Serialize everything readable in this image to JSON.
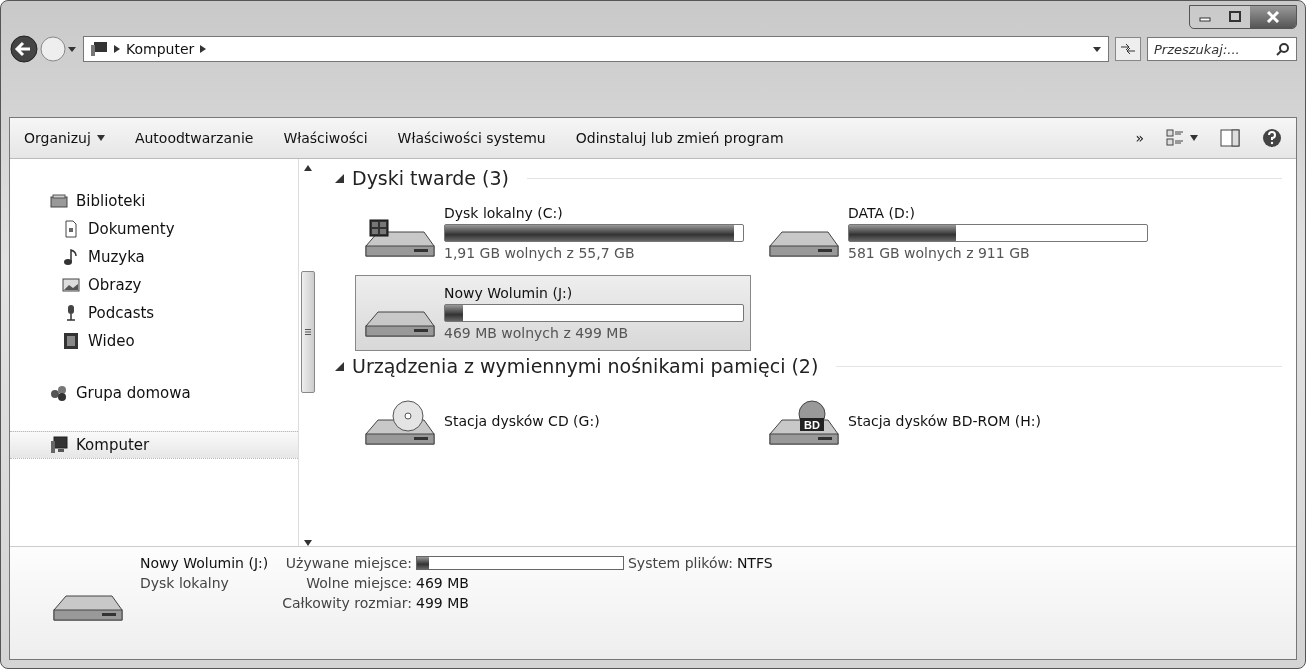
{
  "address_bar": {
    "crumbs": [
      "Komputer"
    ],
    "search": {
      "placeholder": "Przeszukaj:..."
    }
  },
  "toolbar": {
    "items": [
      {
        "label": "Organizuj",
        "dropdown": true
      },
      {
        "label": "Autoodtwarzanie",
        "dropdown": false
      },
      {
        "label": "Właściwości",
        "dropdown": false
      },
      {
        "label": "Właściwości systemu",
        "dropdown": false
      },
      {
        "label": "Odinstaluj lub zmień program",
        "dropdown": false
      }
    ],
    "overflow": "»"
  },
  "sidebar": {
    "groups": [
      {
        "label": "Biblioteki",
        "selected": false,
        "children": [
          {
            "label": "Dokumenty",
            "selected": false
          },
          {
            "label": "Muzyka",
            "selected": false
          },
          {
            "label": "Obrazy",
            "selected": false
          },
          {
            "label": "Podcasts",
            "selected": false
          },
          {
            "label": "Wideo",
            "selected": false
          }
        ]
      },
      {
        "label": "Grupa domowa",
        "selected": false
      },
      {
        "label": "Komputer",
        "selected": true
      }
    ]
  },
  "sections": [
    {
      "title": "Dyski twarde (3)",
      "expanded": true,
      "items": [
        {
          "name": "Dysk lokalny (C:)",
          "kind": "disk",
          "level": 0.97,
          "free": "1,91 GB wolnych z 55,7 GB",
          "selected": false
        },
        {
          "name": "DATA (D:)",
          "kind": "disk",
          "level": 0.36,
          "free": "581 GB wolnych z 911 GB",
          "selected": false
        },
        {
          "name": "Nowy Wolumin (J:)",
          "kind": "disk",
          "level": 0.06,
          "free": "469 MB wolnych z 499 MB",
          "selected": true
        }
      ]
    },
    {
      "title": "Urządzenia z wymiennymi nośnikami pamięci (2)",
      "expanded": true,
      "items": [
        {
          "name": "Stacja dysków CD (G:)",
          "kind": "optical",
          "selected": false
        },
        {
          "name": "Stacja dysków BD-ROM (H:)",
          "kind": "optical",
          "badge": "BD",
          "selected": false
        }
      ]
    }
  ],
  "details": {
    "name": "Nowy Wolumin (J:)",
    "type": "Dysk lokalny",
    "used_label": "Używane miejsce:",
    "level": 0.06,
    "filesystem_label": "System plików:",
    "filesystem": "NTFS",
    "rows": [
      {
        "label": "Wolne miejsce:",
        "value": "469 MB"
      },
      {
        "label": "Całkowity rozmiar:",
        "value": "499 MB"
      }
    ]
  }
}
